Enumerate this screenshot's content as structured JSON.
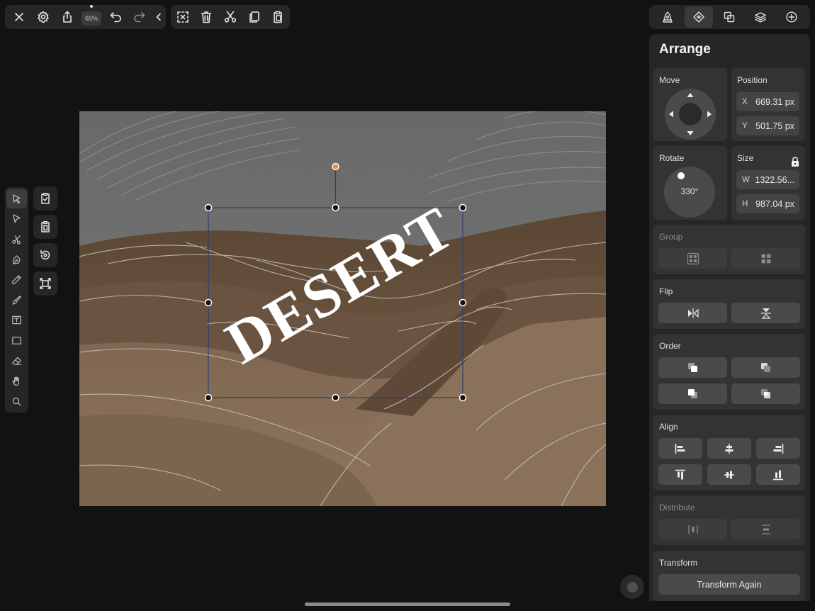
{
  "toolbar": {
    "zoom_label": "65%",
    "left_icons": [
      "close-icon",
      "settings-icon",
      "share-icon",
      "zoom-indicator",
      "undo-icon",
      "redo-icon",
      "collapse-chevron-icon"
    ],
    "edit_icons": [
      "deselect-icon",
      "trash-icon",
      "cut-icon",
      "copy-icon",
      "paste-icon"
    ]
  },
  "tools": [
    "selection-tool",
    "node-tool",
    "scissors-tool",
    "pen-tool",
    "pencil-tool",
    "brush-tool",
    "text-tool",
    "shape-tool",
    "eraser-tool",
    "hand-tool",
    "zoom-tool"
  ],
  "quick_actions": [
    "checklist-icon",
    "paste-style-icon",
    "reset-rotation-icon",
    "fit-frame-icon"
  ],
  "canvas": {
    "artwork_text": "DESERT",
    "rotation_deg": 330
  },
  "panel_tabs": [
    "style-tab",
    "arrange-tab",
    "path-ops-tab",
    "layers-tab",
    "add-tab"
  ],
  "panel": {
    "title": "Arrange",
    "move": {
      "label": "Move"
    },
    "position": {
      "label": "Position",
      "x_key": "X",
      "x_value": "669.31 px",
      "y_key": "Y",
      "y_value": "501.75 px"
    },
    "rotate": {
      "label": "Rotate",
      "value": "330°"
    },
    "size": {
      "label": "Size",
      "w_key": "W",
      "w_value": "1322.56...",
      "h_key": "H",
      "h_value": "987.04 px",
      "locked": true
    },
    "group": {
      "label": "Group"
    },
    "flip": {
      "label": "Flip"
    },
    "order": {
      "label": "Order"
    },
    "align": {
      "label": "Align"
    },
    "distribute": {
      "label": "Distribute"
    },
    "transform": {
      "label": "Transform",
      "button": "Transform Again"
    }
  },
  "colors": {
    "background": "#121212",
    "panel": "#262626",
    "card": "#333333",
    "selection_line": "#2f3f6e",
    "rotation_handle": "#f08a3a"
  }
}
